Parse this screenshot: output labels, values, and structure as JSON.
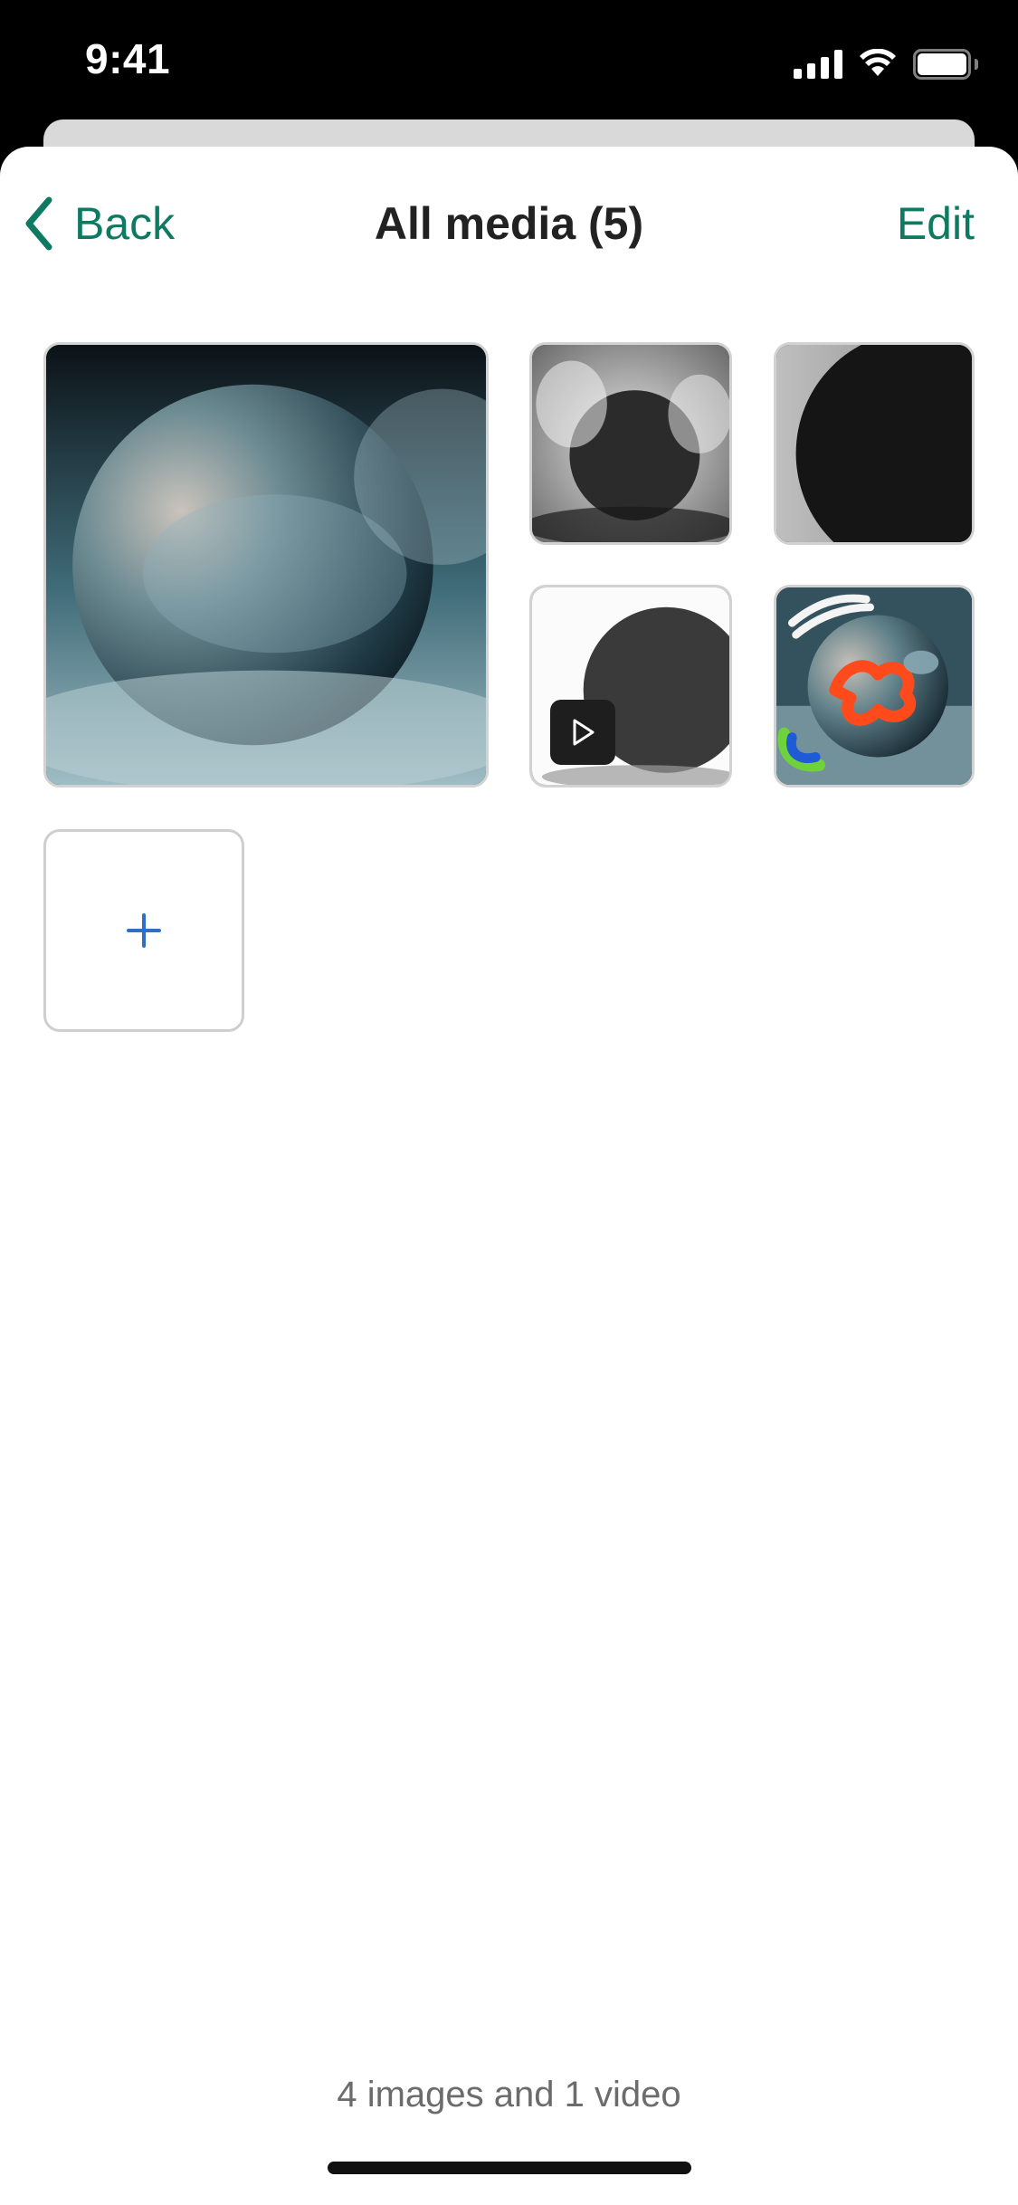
{
  "status_bar": {
    "time": "9:41",
    "icons": [
      "cellular-signal-icon",
      "wifi-icon",
      "battery-icon"
    ]
  },
  "nav": {
    "back_label": "Back",
    "title": "All media (5)",
    "edit_label": "Edit",
    "accent_color": "#0f7a62"
  },
  "media": {
    "items": [
      {
        "type": "image",
        "description": "sphere-in-fog"
      },
      {
        "type": "image",
        "description": "dark-sphere-with-smoke"
      },
      {
        "type": "image",
        "description": "dark-sphere-closeup"
      },
      {
        "type": "video",
        "description": "sphere-on-white",
        "badge_icon": "play-icon"
      },
      {
        "type": "image",
        "description": "sphere-with-drawing-marks"
      }
    ],
    "add_icon": "plus-icon",
    "add_icon_color": "#2f6fc9"
  },
  "footer": {
    "summary": "4 images and 1 video"
  }
}
